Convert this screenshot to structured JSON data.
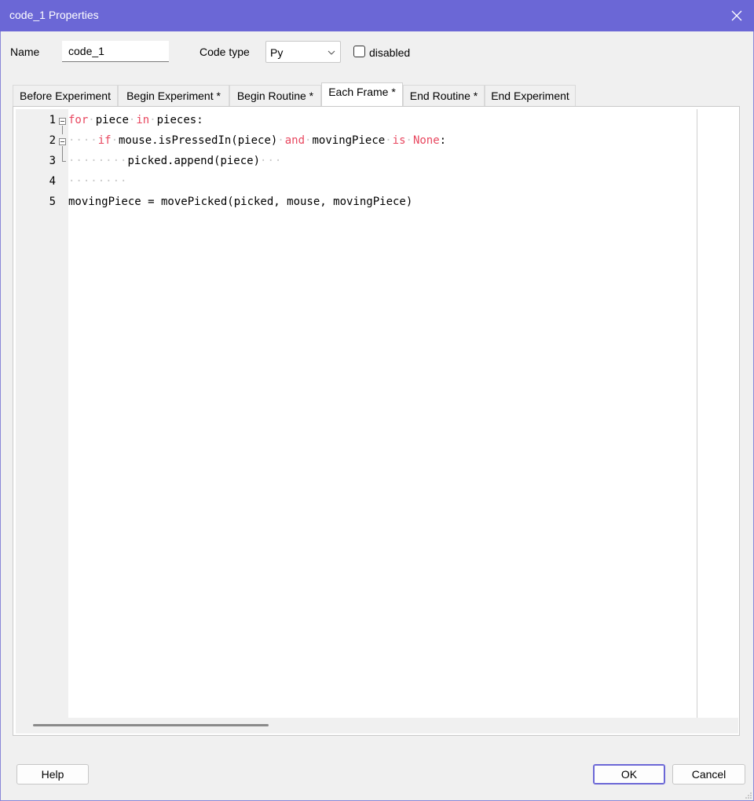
{
  "window": {
    "title": "code_1 Properties",
    "close_icon": "close-icon"
  },
  "form": {
    "name_label": "Name",
    "name_value": "code_1",
    "code_type_label": "Code type",
    "code_type_value": "Py",
    "disabled_label": "disabled",
    "disabled_checked": false
  },
  "tabs": [
    {
      "label": "Before Experiment",
      "active": false
    },
    {
      "label": "Begin Experiment *",
      "active": false
    },
    {
      "label": "Begin Routine *",
      "active": false
    },
    {
      "label": "Each Frame *",
      "active": true
    },
    {
      "label": "End Routine *",
      "active": false
    },
    {
      "label": "End Experiment",
      "active": false
    }
  ],
  "editor": {
    "line_numbers": [
      "1",
      "2",
      "3",
      "4",
      "5"
    ],
    "lines": [
      {
        "segments": [
          [
            "kw",
            "for"
          ],
          [
            "dots",
            "·"
          ],
          [
            "txt",
            "piece"
          ],
          [
            "dots",
            "·"
          ],
          [
            "kw",
            "in"
          ],
          [
            "dots",
            "·"
          ],
          [
            "txt",
            "pieces:"
          ]
        ]
      },
      {
        "segments": [
          [
            "dots",
            "····"
          ],
          [
            "kw",
            "if"
          ],
          [
            "dots",
            "·"
          ],
          [
            "txt",
            "mouse.isPressedIn(piece)"
          ],
          [
            "dots",
            "·"
          ],
          [
            "kw",
            "and"
          ],
          [
            "dots",
            "·"
          ],
          [
            "txt",
            "movingPiece"
          ],
          [
            "dots",
            "·"
          ],
          [
            "kw",
            "is"
          ],
          [
            "dots",
            "·"
          ],
          [
            "kw",
            "None"
          ],
          [
            "txt",
            ":"
          ]
        ]
      },
      {
        "segments": [
          [
            "dots",
            "········"
          ],
          [
            "txt",
            "picked.append(piece)"
          ],
          [
            "dots",
            "···"
          ]
        ]
      },
      {
        "segments": [
          [
            "dots",
            "········"
          ]
        ]
      },
      {
        "segments": [
          [
            "txt",
            "movingPiece = movePicked(picked, mouse, movingPiece)"
          ]
        ]
      }
    ],
    "colors": {
      "keyword": "#e8475f",
      "whitespace_dots": "#c8c8c8"
    }
  },
  "buttons": {
    "help": "Help",
    "ok": "OK",
    "cancel": "Cancel"
  },
  "colors": {
    "titlebar": "#6b67d6",
    "background": "#f0f0f0"
  }
}
